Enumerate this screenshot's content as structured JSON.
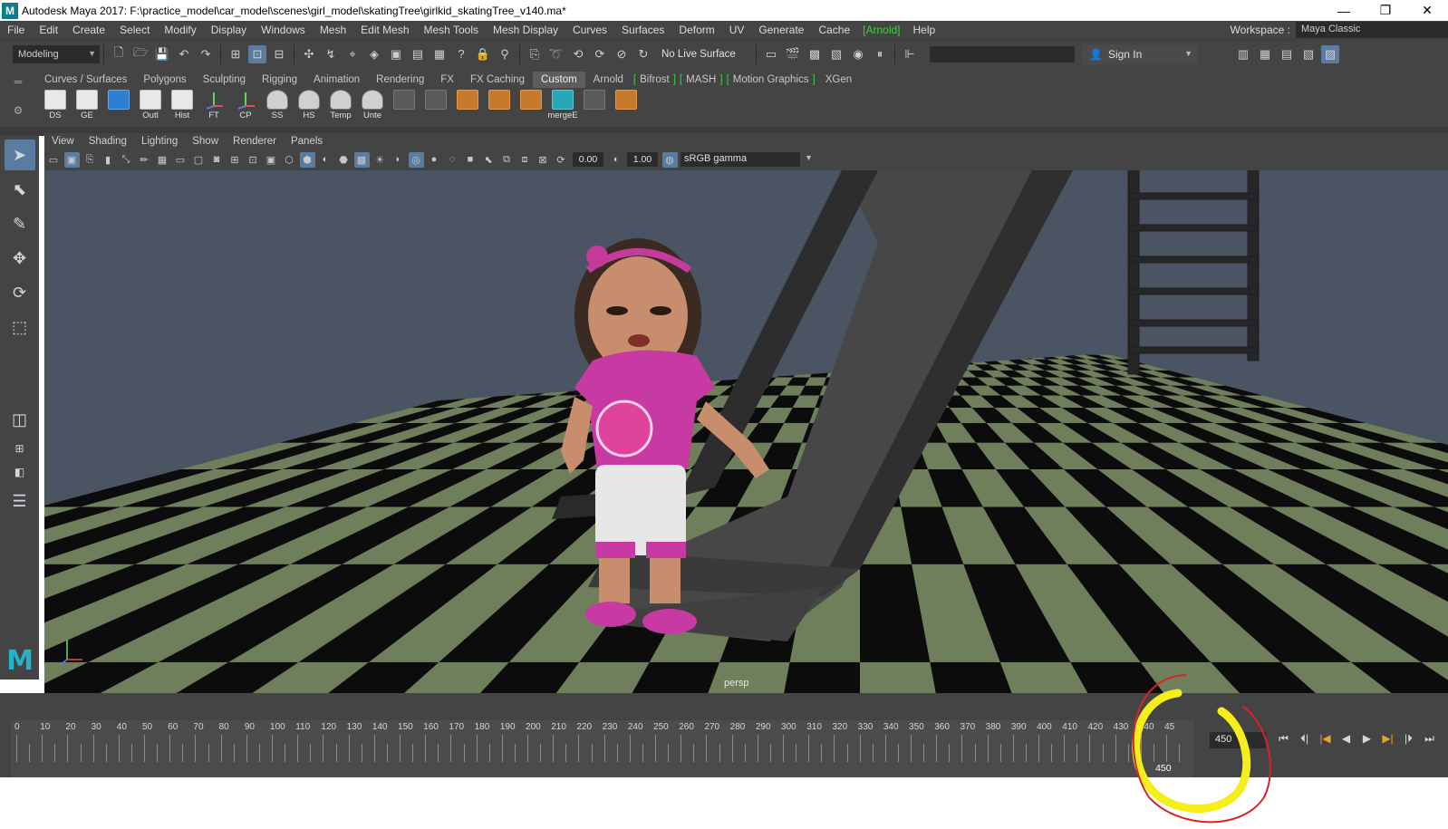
{
  "window": {
    "title": "Autodesk Maya 2017: F:\\practice_model\\car_model\\scenes\\girl_model\\skatingTree\\girlkid_skatingTree_v140.ma*",
    "logo_letter": "M",
    "minimize": "—",
    "restore": "❐",
    "close": "✕"
  },
  "menubar": {
    "items": [
      "File",
      "Edit",
      "Create",
      "Select",
      "Modify",
      "Display",
      "Windows",
      "Mesh",
      "Edit Mesh",
      "Mesh Tools",
      "Mesh Display",
      "Curves",
      "Surfaces",
      "Deform",
      "UV",
      "Generate",
      "Cache"
    ],
    "arnold": "[Arnold]",
    "help": "Help",
    "workspace_label": "Workspace :",
    "workspace_value": "Maya Classic"
  },
  "statusline": {
    "mode": "Modeling",
    "live_surface": "No Live Surface",
    "sign_in": "Sign In"
  },
  "shelf": {
    "tabs": [
      "Curves / Surfaces",
      "Polygons",
      "Sculpting",
      "Rigging",
      "Animation",
      "Rendering",
      "FX",
      "FX Caching",
      "Custom",
      "Arnold"
    ],
    "active_tab": "Custom",
    "bracket_tabs": [
      "Bifrost",
      "MASH",
      "Motion Graphics"
    ],
    "xgen": "XGen",
    "icons": [
      {
        "caption": "DS",
        "icon": "display-smooth-icon"
      },
      {
        "caption": "GE",
        "icon": "graph-editor-icon"
      },
      {
        "caption": "",
        "icon": "sphere-icon"
      },
      {
        "caption": "Outl",
        "icon": "outliner-icon"
      },
      {
        "caption": "Hist",
        "icon": "history-icon"
      },
      {
        "caption": "FT",
        "icon": "freeze-transform-icon"
      },
      {
        "caption": "CP",
        "icon": "center-pivot-icon"
      },
      {
        "caption": "SS",
        "icon": "show-selected-icon"
      },
      {
        "caption": "HS",
        "icon": "hide-selected-icon"
      },
      {
        "caption": "Temp",
        "icon": "template-icon"
      },
      {
        "caption": "Unte",
        "icon": "untemplate-icon"
      },
      {
        "caption": "",
        "icon": "uv-checker-icon"
      },
      {
        "caption": "",
        "icon": "uv-layout-icon"
      },
      {
        "caption": "",
        "icon": "extract-icon"
      },
      {
        "caption": "",
        "icon": "separate-icon"
      },
      {
        "caption": "",
        "icon": "combine-icon"
      },
      {
        "caption": "mergeE",
        "icon": "merge-edges-icon"
      },
      {
        "caption": "",
        "icon": "bridge-icon"
      },
      {
        "caption": "",
        "icon": "mirror-icon"
      }
    ]
  },
  "panel": {
    "menus": [
      "View",
      "Shading",
      "Lighting",
      "Show",
      "Renderer",
      "Panels"
    ],
    "exposure": "0.00",
    "gamma": "1.00",
    "color_space": "sRGB gamma",
    "camera": "persp"
  },
  "timeslider": {
    "ticks": [
      "0",
      "10",
      "20",
      "30",
      "40",
      "50",
      "60",
      "70",
      "80",
      "90",
      "100",
      "110",
      "120",
      "130",
      "140",
      "150",
      "160",
      "170",
      "180",
      "190",
      "200",
      "210",
      "220",
      "230",
      "240",
      "250",
      "260",
      "270",
      "280",
      "290",
      "300",
      "310",
      "320",
      "330",
      "340",
      "350",
      "360",
      "370",
      "380",
      "390",
      "400",
      "410",
      "420",
      "430",
      "440",
      "45"
    ],
    "current_frame": "450",
    "marker_label": "450"
  },
  "colors": {
    "ui_bg": "#444444",
    "viewport_bg": "#4b5462",
    "floor_green": "#6f7f5c",
    "accent_blue": "#5a7ca0",
    "arnold_green": "#3bd23b",
    "annotation_yellow": "#f5ee1a",
    "annotation_red": "#d8232a"
  }
}
